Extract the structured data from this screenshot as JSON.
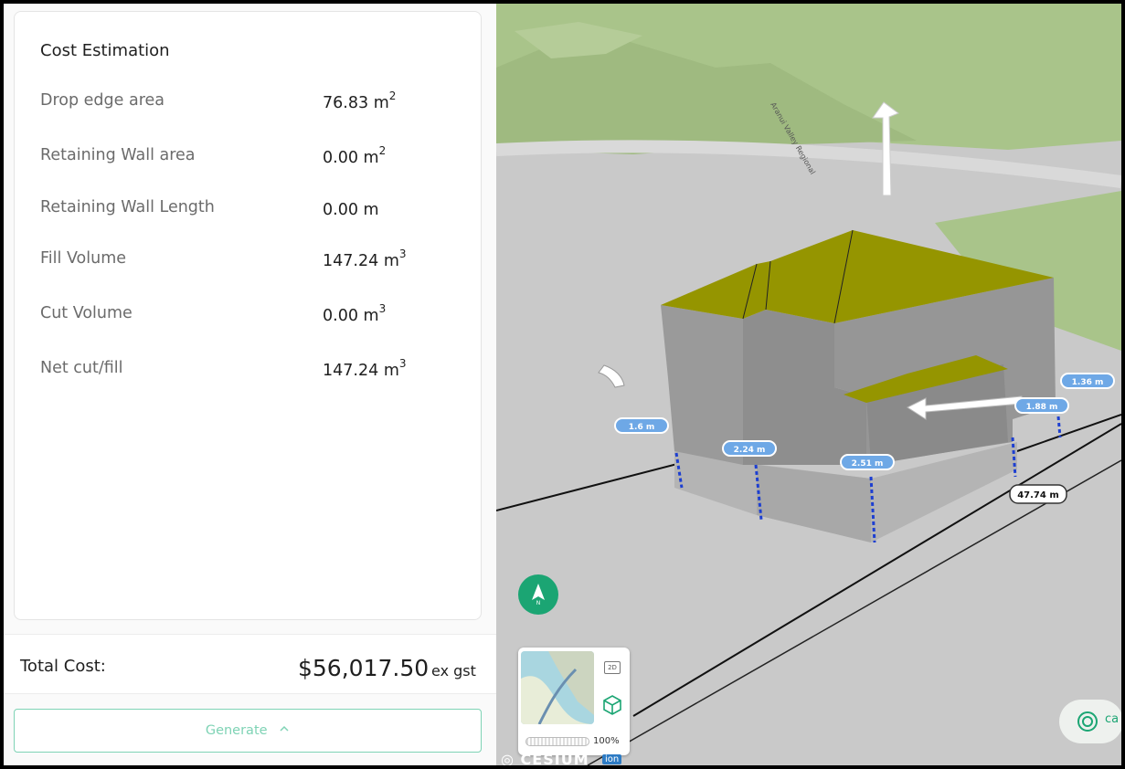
{
  "panel": {
    "title": "Cost Estimation",
    "rows": [
      {
        "label": "Drop edge area",
        "value": "76.83",
        "unit": "m",
        "exp": "2"
      },
      {
        "label": "Retaining Wall area",
        "value": "0.00",
        "unit": "m",
        "exp": "2"
      },
      {
        "label": "Retaining Wall Length",
        "value": "0.00",
        "unit": "m",
        "exp": ""
      },
      {
        "label": "Fill Volume",
        "value": "147.24",
        "unit": "m",
        "exp": "3"
      },
      {
        "label": "Cut Volume",
        "value": "0.00",
        "unit": "m",
        "exp": "3"
      },
      {
        "label": "Net cut/fill",
        "value": "147.24",
        "unit": "m",
        "exp": "3"
      }
    ]
  },
  "total": {
    "label": "Total Cost:",
    "value": "$56,017.50",
    "unit": "ex gst"
  },
  "generate": {
    "label": "Generate"
  },
  "map": {
    "road_label": "Aranui Valley Regional",
    "measurements": [
      "1.6 m",
      "2.24 m",
      "2.51 m",
      "1.88 m",
      "1.36 m",
      "47.74 m"
    ],
    "compass_label": "N",
    "minimap": {
      "mode_2d": "2D",
      "opacity": "100%",
      "opacity_level": 1.0
    },
    "attribution": "CESIUM",
    "attribution_badge": "ion",
    "corner_text": "ca"
  },
  "colors": {
    "accent": "#1ba573",
    "button_text": "#7fd3b5",
    "roof": "#959500",
    "wall": "#979797",
    "ground": "#c9c9c9",
    "terrain": "#a9c48a",
    "label_fill": "#6ea8e6"
  }
}
